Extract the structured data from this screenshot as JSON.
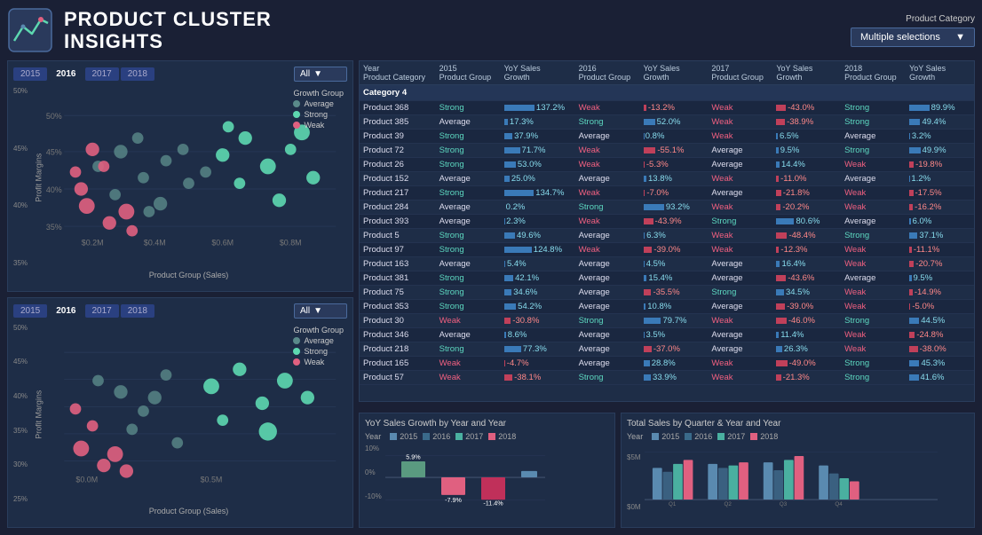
{
  "header": {
    "title_line1": "PRODUCT CLUSTER",
    "title_line2": "INSIGHTS",
    "product_category_label": "Product Category",
    "product_category_value": "Multiple selections",
    "dropdown_arrow": "▼"
  },
  "filters": {
    "years": [
      "2015",
      "2016",
      "2017",
      "2018"
    ],
    "active_year_top": "2016",
    "active_year_bottom": "2016",
    "filter_label": "All"
  },
  "scatter_top": {
    "title": "Growth Group",
    "legend": [
      {
        "label": "Average",
        "color": "#5a8a8a"
      },
      {
        "label": "Strong",
        "color": "#5dd8b0"
      },
      {
        "label": "Weak",
        "color": "#e06080"
      }
    ],
    "y_label": "Profit Margins",
    "x_label": "Product Group (Sales)",
    "y_ticks": [
      "50%",
      "45%",
      "40%",
      "35%"
    ],
    "x_ticks": [
      "$0.2M",
      "$0.4M",
      "$0.6M",
      "$0.8M"
    ]
  },
  "scatter_bottom": {
    "title": "Growth Group",
    "legend": [
      {
        "label": "Average",
        "color": "#5a8a8a"
      },
      {
        "label": "Strong",
        "color": "#5dd8b0"
      },
      {
        "label": "Weak",
        "color": "#e06080"
      }
    ],
    "y_label": "Profit Margins",
    "x_label": "Product Group (Sales)",
    "y_ticks": [
      "50%",
      "45%",
      "40%",
      "35%",
      "30%",
      "25%"
    ],
    "x_ticks": [
      "$0.0M",
      "$0.5M"
    ]
  },
  "table": {
    "headers": [
      {
        "label": "Year",
        "sub": "Product Category"
      },
      {
        "label": "2015",
        "sub": "Product Group"
      },
      {
        "label": "YoY Sales",
        "sub": "Growth"
      },
      {
        "label": "2016",
        "sub": "Product Group"
      },
      {
        "label": "YoY Sales",
        "sub": "Growth"
      },
      {
        "label": "2017",
        "sub": "Product Group"
      },
      {
        "label": "YoY Sales",
        "sub": "Growth"
      },
      {
        "label": "2018",
        "sub": "Product Group"
      },
      {
        "label": "YoY Sales",
        "sub": "Growth"
      }
    ],
    "category": "Category 4",
    "rows": [
      {
        "name": "Product 368",
        "g2015": "Strong",
        "v2015": "137.2%",
        "g2016": "Weak",
        "v2016": "-13.2%",
        "g2017": "Weak",
        "v2017": "-43.0%",
        "g2018": "Strong",
        "v2018": "89.9%"
      },
      {
        "name": "Product 385",
        "g2015": "Average",
        "v2015": "17.3%",
        "g2016": "Strong",
        "v2016": "52.0%",
        "g2017": "Weak",
        "v2017": "-38.9%",
        "g2018": "Strong",
        "v2018": "49.4%"
      },
      {
        "name": "Product 39",
        "g2015": "Strong",
        "v2015": "37.9%",
        "g2016": "Average",
        "v2016": "0.8%",
        "g2017": "Weak",
        "v2017": "6.5%",
        "g2018": "Average",
        "v2018": "3.2%"
      },
      {
        "name": "Product 72",
        "g2015": "Strong",
        "v2015": "71.7%",
        "g2016": "Weak",
        "v2016": "-55.1%",
        "g2017": "Average",
        "v2017": "9.5%",
        "g2018": "Strong",
        "v2018": "49.9%"
      },
      {
        "name": "Product 26",
        "g2015": "Strong",
        "v2015": "53.0%",
        "g2016": "Weak",
        "v2016": "-5.3%",
        "g2017": "Average",
        "v2017": "14.4%",
        "g2018": "Weak",
        "v2018": "-19.8%"
      },
      {
        "name": "Product 152",
        "g2015": "Average",
        "v2015": "25.0%",
        "g2016": "Average",
        "v2016": "13.8%",
        "g2017": "Weak",
        "v2017": "-11.0%",
        "g2018": "Average",
        "v2018": "1.2%"
      },
      {
        "name": "Product 217",
        "g2015": "Strong",
        "v2015": "134.7%",
        "g2016": "Weak",
        "v2016": "-7.0%",
        "g2017": "Average",
        "v2017": "-21.8%",
        "g2018": "Weak",
        "v2018": "-17.5%"
      },
      {
        "name": "Product 284",
        "g2015": "Average",
        "v2015": "0.2%",
        "g2016": "Strong",
        "v2016": "93.2%",
        "g2017": "Weak",
        "v2017": "-20.2%",
        "g2018": "Weak",
        "v2018": "-16.2%"
      },
      {
        "name": "Product 393",
        "g2015": "Average",
        "v2015": "2.3%",
        "g2016": "Weak",
        "v2016": "-43.9%",
        "g2017": "Strong",
        "v2017": "80.6%",
        "g2018": "Average",
        "v2018": "6.0%"
      },
      {
        "name": "Product 5",
        "g2015": "Strong",
        "v2015": "49.6%",
        "g2016": "Average",
        "v2016": "6.3%",
        "g2017": "Weak",
        "v2017": "-48.4%",
        "g2018": "Strong",
        "v2018": "37.1%"
      },
      {
        "name": "Product 97",
        "g2015": "Strong",
        "v2015": "124.8%",
        "g2016": "Weak",
        "v2016": "-39.0%",
        "g2017": "Weak",
        "v2017": "-12.3%",
        "g2018": "Weak",
        "v2018": "-11.1%"
      },
      {
        "name": "Product 163",
        "g2015": "Average",
        "v2015": "5.4%",
        "g2016": "Average",
        "v2016": "4.5%",
        "g2017": "Average",
        "v2017": "16.4%",
        "g2018": "Weak",
        "v2018": "-20.7%"
      },
      {
        "name": "Product 381",
        "g2015": "Strong",
        "v2015": "42.1%",
        "g2016": "Average",
        "v2016": "15.4%",
        "g2017": "Average",
        "v2017": "-43.6%",
        "g2018": "Average",
        "v2018": "9.5%"
      },
      {
        "name": "Product 75",
        "g2015": "Strong",
        "v2015": "34.6%",
        "g2016": "Average",
        "v2016": "-35.5%",
        "g2017": "Strong",
        "v2017": "34.5%",
        "g2018": "Weak",
        "v2018": "-14.9%"
      },
      {
        "name": "Product 353",
        "g2015": "Strong",
        "v2015": "54.2%",
        "g2016": "Average",
        "v2016": "10.8%",
        "g2017": "Average",
        "v2017": "-39.0%",
        "g2018": "Weak",
        "v2018": "-5.0%"
      },
      {
        "name": "Product 30",
        "g2015": "Weak",
        "v2015": "-30.8%",
        "g2016": "Strong",
        "v2016": "79.7%",
        "g2017": "Weak",
        "v2017": "-46.0%",
        "g2018": "Strong",
        "v2018": "44.5%"
      },
      {
        "name": "Product 346",
        "g2015": "Average",
        "v2015": "8.6%",
        "g2016": "Average",
        "v2016": "3.5%",
        "g2017": "Average",
        "v2017": "11.4%",
        "g2018": "Weak",
        "v2018": "-24.8%"
      },
      {
        "name": "Product 218",
        "g2015": "Strong",
        "v2015": "77.3%",
        "g2016": "Average",
        "v2016": "-37.0%",
        "g2017": "Average",
        "v2017": "26.3%",
        "g2018": "Weak",
        "v2018": "-38.0%"
      },
      {
        "name": "Product 165",
        "g2015": "Weak",
        "v2015": "-4.7%",
        "g2016": "Average",
        "v2016": "28.8%",
        "g2017": "Weak",
        "v2017": "-49.0%",
        "g2018": "Strong",
        "v2018": "45.3%"
      },
      {
        "name": "Product 57",
        "g2015": "Weak",
        "v2015": "-38.1%",
        "g2016": "Strong",
        "v2016": "33.9%",
        "g2017": "Weak",
        "v2017": "-21.3%",
        "g2018": "Strong",
        "v2018": "41.6%"
      }
    ]
  },
  "yoy_chart": {
    "title": "YoY Sales Growth by Year and Year",
    "year_label": "Year",
    "years": [
      "2015",
      "2016",
      "2017",
      "2018"
    ],
    "year_colors": [
      "#5a8ab0",
      "#3a6a8a",
      "#4ab0a0",
      "#e06080"
    ],
    "bars": [
      {
        "year": "2015",
        "value": 5.9,
        "label": "5.9%"
      },
      {
        "year": "2016",
        "value": -7.9,
        "label": "-7.9%"
      },
      {
        "year": "2017",
        "value": -11.4,
        "label": "-11.4%"
      },
      {
        "year": "2018",
        "value": 3.2,
        "label": ""
      }
    ],
    "y_ticks": [
      "10%",
      "0%",
      "-10%"
    ]
  },
  "total_sales_chart": {
    "title": "Total Sales by Quarter & Year and Year",
    "year_label": "Year",
    "years": [
      "2015",
      "2016",
      "2017",
      "2018"
    ],
    "year_colors": [
      "#5a8ab0",
      "#3a6a8a",
      "#4ab0a0",
      "#e06080"
    ],
    "y_ticks": [
      "$5M",
      "$0M"
    ],
    "quarters": [
      "Q1",
      "Q2",
      "Q3",
      "Q4"
    ]
  }
}
